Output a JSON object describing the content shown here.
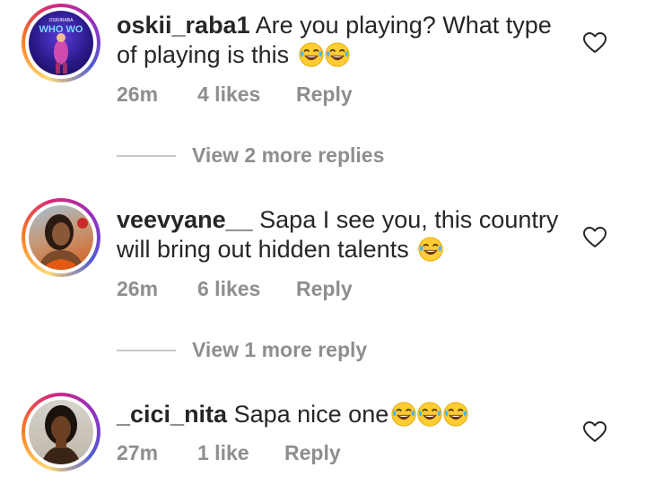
{
  "comments": [
    {
      "username": "oskii_raba1",
      "text": "Are you playing? What type of playing is this",
      "emoji_count": 2,
      "time": "26m",
      "likes": "4 likes",
      "reply": "Reply",
      "view_replies": "View 2 more replies",
      "avatar_badge": "WHO WO",
      "avatar_small": "OSKIIRABA"
    },
    {
      "username": "veevyane__",
      "text": "Sapa I see you, this country will bring out hidden talents",
      "emoji_count": 1,
      "time": "26m",
      "likes": "6 likes",
      "reply": "Reply",
      "view_replies": "View 1 more reply"
    },
    {
      "username": "_cici_nita",
      "text": "Sapa nice one",
      "emoji_count": 3,
      "time": "27m",
      "likes": "1 like",
      "reply": "Reply"
    }
  ],
  "icons": {
    "emoji": "face-with-tears-of-joy-icon",
    "like": "heart-outline-icon"
  },
  "colors": {
    "text": "#262626",
    "meta": "#8e8e8e",
    "divider": "#c7c7c7"
  }
}
